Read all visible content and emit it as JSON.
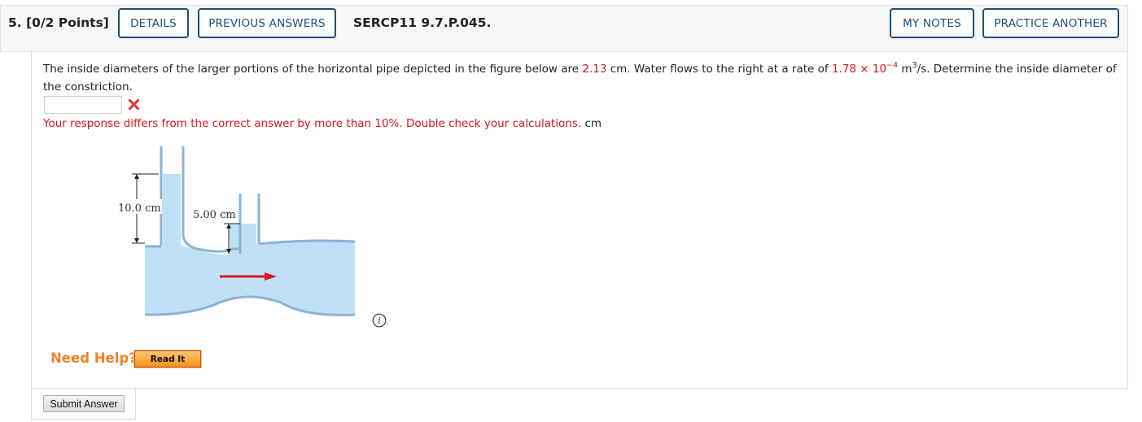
{
  "header": {
    "question_number": "5.",
    "points": "[0/2 Points]",
    "details_label": "DETAILS",
    "previous_answers_label": "PREVIOUS ANSWERS",
    "question_code": "SERCP11 9.7.P.045.",
    "my_notes_label": "MY NOTES",
    "practice_another_label": "PRACTICE ANOTHER"
  },
  "question": {
    "text_1": "The inside diameters of the larger portions of the horizontal pipe depicted in the figure below are ",
    "diameter_value": "2.13",
    "text_2": " cm. Water flows to the right at a rate of ",
    "flow_rate_mantissa": "1.78 × 10",
    "flow_rate_exponent": "−4",
    "text_3": " m",
    "unit_exponent": "3",
    "text_4": "/s. Determine the inside diameter of the constriction."
  },
  "answer": {
    "value": "",
    "status": "incorrect",
    "feedback": "Your response differs from the correct answer by more than 10%. Double check your calculations.",
    "unit": "cm"
  },
  "figure": {
    "label_left": "10.0 cm",
    "label_right": "5.00 cm",
    "water_color": "#bfe0f5",
    "arrow_color": "#d71920"
  },
  "help": {
    "need_help_label": "Need Help?",
    "read_it_label": "Read It"
  },
  "submit_label": "Submit Answer",
  "colors": {
    "accent": "#1c4f7a",
    "error": "#d0161e",
    "help_orange": "#f0822a"
  }
}
